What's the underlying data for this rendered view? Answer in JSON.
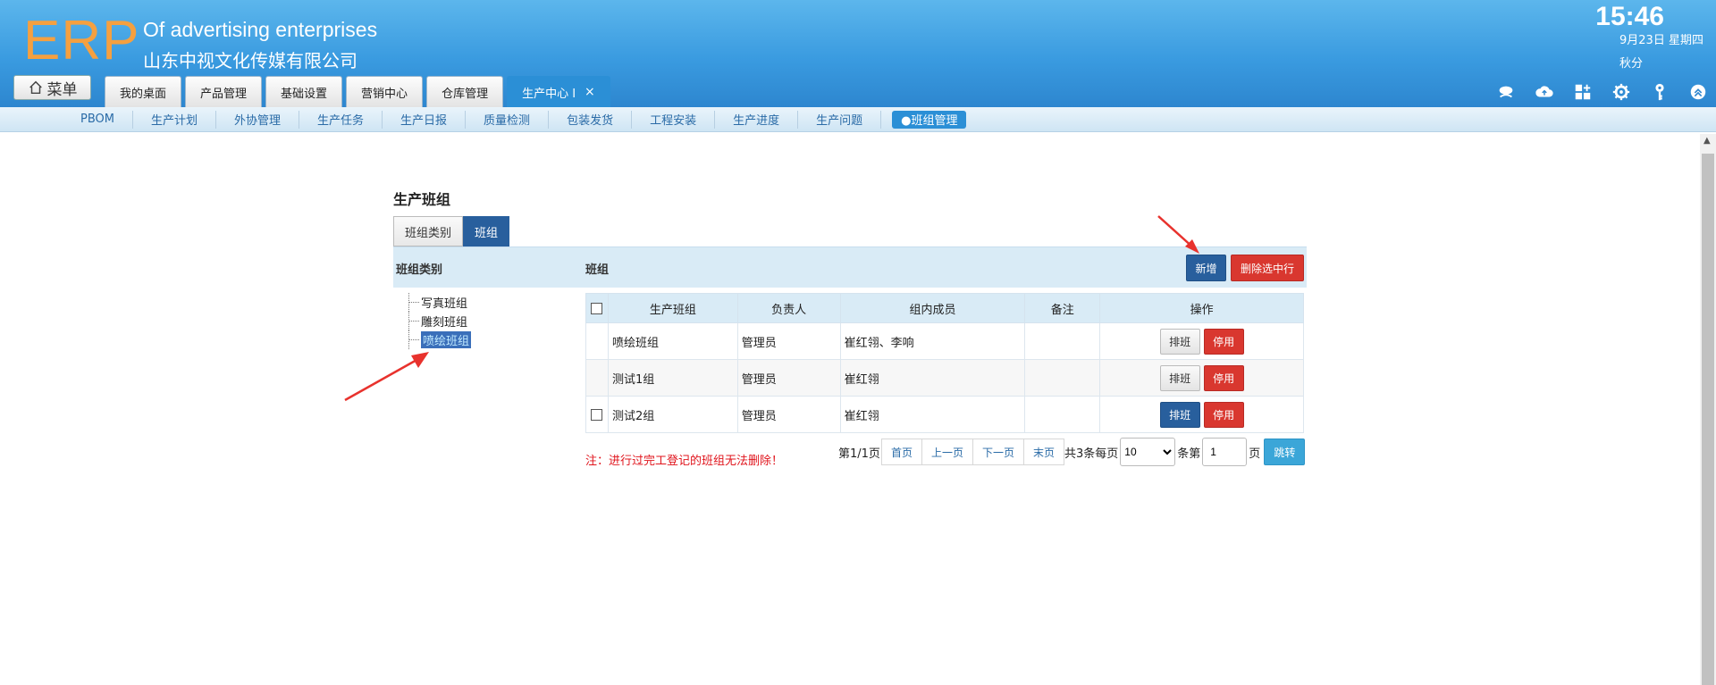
{
  "header": {
    "logo": "ERP",
    "company_en": "Of advertising enterprises",
    "company_cn": "山东中视文化传媒有限公司",
    "time": "15:46",
    "date": "9月23日 星期四",
    "season": "秋分",
    "menu_label": "菜单"
  },
  "tabs": [
    {
      "label": "我的桌面"
    },
    {
      "label": "产品管理"
    },
    {
      "label": "基础设置"
    },
    {
      "label": "营销中心"
    },
    {
      "label": "仓库管理"
    },
    {
      "label": "生产中心 I",
      "close": "×"
    }
  ],
  "subnav": [
    {
      "label": "PBOM"
    },
    {
      "label": "生产计划"
    },
    {
      "label": "外协管理"
    },
    {
      "label": "生产任务"
    },
    {
      "label": "生产日报"
    },
    {
      "label": "质量检测"
    },
    {
      "label": "包装发货"
    },
    {
      "label": "工程安装"
    },
    {
      "label": "生产进度"
    },
    {
      "label": "生产问题"
    },
    {
      "label": "●班组管理"
    }
  ],
  "page": {
    "title": "生产班组",
    "subtabs": [
      {
        "label": "班组类别"
      },
      {
        "label": "班组"
      }
    ],
    "left_header": "班组类别",
    "right_header": "班组",
    "add_label": "新增",
    "delete_label": "删除选中行"
  },
  "tree": [
    {
      "label": "写真班组"
    },
    {
      "label": "雕刻班组"
    },
    {
      "label": "喷绘班组"
    }
  ],
  "table": {
    "headers": [
      "生产班组",
      "负责人",
      "组内成员",
      "备注",
      "操作"
    ],
    "rows": [
      {
        "name": "喷绘班组",
        "leader": "管理员",
        "members": "崔红翎、李响",
        "remark": "",
        "sched": "排班",
        "stop": "停用"
      },
      {
        "name": "测试1组",
        "leader": "管理员",
        "members": "崔红翎",
        "remark": "",
        "sched": "排班",
        "stop": "停用"
      },
      {
        "name": "测试2组",
        "leader": "管理员",
        "members": "崔红翎",
        "remark": "",
        "sched": "排班",
        "stop": "停用"
      }
    ]
  },
  "note": "注：进行过完工登记的班组无法删除！",
  "pager": {
    "page_info": "第1/1页",
    "first": "首页",
    "prev": "上一页",
    "next": "下一页",
    "last": "末页",
    "total_text": "共3条每页",
    "page_size": "10",
    "goto_pre": "条第",
    "goto_value": "1",
    "goto_post": "页",
    "jump": "跳转"
  },
  "colors": {
    "header_blue": "#3a9be0",
    "logo_orange": "#f5a040",
    "primary": "#285f9d",
    "danger": "#d9372f",
    "annotation": "#e8322d"
  }
}
